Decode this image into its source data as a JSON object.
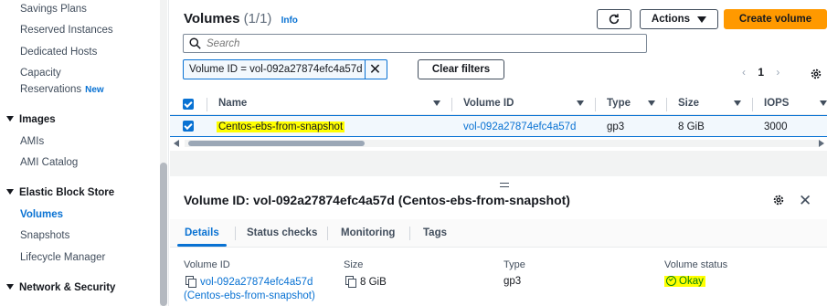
{
  "sidebar": {
    "items": {
      "savings_plans": "Savings Plans",
      "reserved_instances": "Reserved Instances",
      "dedicated_hosts": "Dedicated Hosts",
      "capacity": "Capacity",
      "reservations": "Reservations",
      "new_badge": "New",
      "images_section": "Images",
      "amis": "AMIs",
      "ami_catalog": "AMI Catalog",
      "ebs_section": "Elastic Block Store",
      "volumes": "Volumes",
      "snapshots": "Snapshots",
      "lifecycle_manager": "Lifecycle Manager",
      "network_section": "Network & Security"
    }
  },
  "header": {
    "title": "Volumes",
    "count": "(1/1)",
    "info": "Info",
    "actions_label": "Actions",
    "create_label": "Create volume"
  },
  "search": {
    "placeholder": "Search"
  },
  "filter": {
    "token": "Volume ID = vol-092a27874efc4a57d",
    "clear_label": "Clear filters"
  },
  "pagination": {
    "page": "1"
  },
  "table": {
    "columns": [
      "Name",
      "Volume ID",
      "Type",
      "Size",
      "IOPS"
    ],
    "rows": [
      {
        "name": "Centos-ebs-from-snapshot",
        "volume_id": "vol-092a27874efc4a57d",
        "type": "gp3",
        "size": "8 GiB",
        "iops": "3000",
        "selected": true
      }
    ]
  },
  "details": {
    "title": "Volume ID: vol-092a27874efc4a57d (Centos-ebs-from-snapshot)",
    "tabs": [
      "Details",
      "Status checks",
      "Monitoring",
      "Tags"
    ],
    "active_tab": "Details",
    "fields": {
      "volume_id_label": "Volume ID",
      "volume_id_value": "vol-092a27874efc4a57d",
      "volume_id_name": "(Centos-ebs-from-snapshot)",
      "size_label": "Size",
      "size_value": "8 GiB",
      "type_label": "Type",
      "type_value": "gp3",
      "status_label": "Volume status",
      "status_value": "Okay"
    }
  },
  "colors": {
    "accent": "#0972d3",
    "primary_button": "#ff9900",
    "highlight": "#ffff00",
    "status_ok": "#037f0c"
  }
}
